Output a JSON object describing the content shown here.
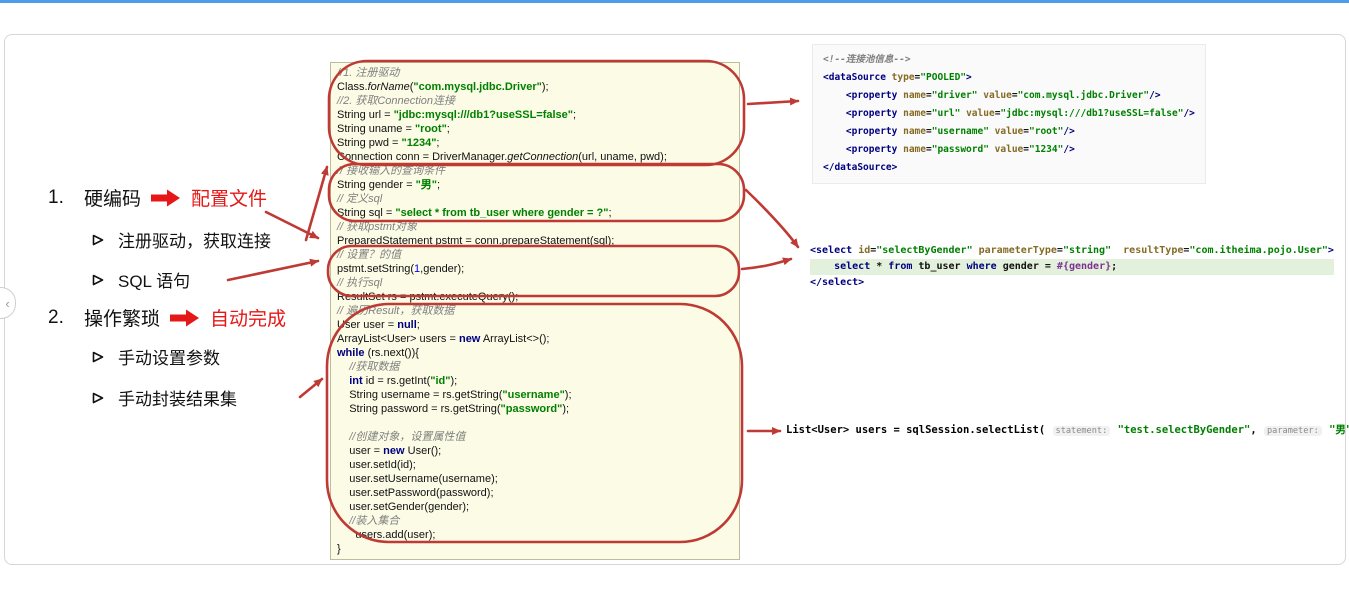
{
  "colors": {
    "top_bar_blue": "#4E9DE9",
    "accent_red_bright": "#E51717",
    "annotation_red": "#BE3A34",
    "code_bg_yellow": "#FBFBE6",
    "string_green": "#008000",
    "keyword_navy": "#000080",
    "highlight_green_bg": "#E3F1DC"
  },
  "side_tab": {
    "glyph": "‹"
  },
  "slide": {
    "outline_items": [
      {
        "number": "1.",
        "title": "硬编码",
        "tag": "配置文件",
        "children": [
          "注册驱动，获取连接",
          "SQL 语句"
        ]
      },
      {
        "number": "2.",
        "title": "操作繁琐",
        "tag": "自动完成",
        "children": [
          "手动设置参数",
          "手动封装结果集"
        ]
      }
    ]
  },
  "java_code": {
    "lines": [
      {
        "tk": [
          [
            "c",
            "//1. 注册驱动"
          ]
        ]
      },
      {
        "tk": [
          [
            "t",
            "Class."
          ],
          [
            "i",
            "forName"
          ],
          [
            "t",
            "("
          ],
          [
            "s",
            "\"com.mysql.jdbc.Driver\""
          ],
          [
            "t",
            ");"
          ]
        ]
      },
      {
        "tk": [
          [
            "c",
            "//2. 获取Connection连接"
          ]
        ]
      },
      {
        "tk": [
          [
            "t",
            "String url = "
          ],
          [
            "s",
            "\"jdbc:mysql:///db1?useSSL=false\""
          ],
          [
            "t",
            ";"
          ]
        ]
      },
      {
        "tk": [
          [
            "t",
            "String uname = "
          ],
          [
            "s",
            "\"root\""
          ],
          [
            "t",
            ";"
          ]
        ]
      },
      {
        "tk": [
          [
            "t",
            "String pwd = "
          ],
          [
            "s",
            "\"1234\""
          ],
          [
            "t",
            ";"
          ]
        ]
      },
      {
        "tk": [
          [
            "t",
            "Connection conn = DriverManager."
          ],
          [
            "i",
            "getConnection"
          ],
          [
            "t",
            "(url, uname, pwd);"
          ]
        ]
      },
      {
        "tk": [
          [
            "c",
            "// 接收输入的查询条件"
          ]
        ]
      },
      {
        "tk": [
          [
            "t",
            "String gender = "
          ],
          [
            "s",
            "\"男\""
          ],
          [
            "t",
            ";"
          ]
        ]
      },
      {
        "tk": [
          [
            "c",
            "// 定义sql"
          ]
        ]
      },
      {
        "tk": [
          [
            "t",
            "String sql = "
          ],
          [
            "s",
            "\"select * from tb_user where gender = ?\""
          ],
          [
            "t",
            ";"
          ]
        ]
      },
      {
        "tk": [
          [
            "c",
            "// 获取pstmt对象"
          ]
        ]
      },
      {
        "tk": [
          [
            "t",
            "PreparedStatement pstmt = conn.prepareStatement(sql);"
          ]
        ]
      },
      {
        "tk": [
          [
            "c",
            "// 设置？的值"
          ]
        ]
      },
      {
        "tk": [
          [
            "t",
            "pstmt.setString("
          ],
          [
            "n",
            "1"
          ],
          [
            "t",
            ",gender);"
          ]
        ]
      },
      {
        "tk": [
          [
            "c",
            "// 执行sql"
          ]
        ]
      },
      {
        "tk": [
          [
            "t",
            "ResultSet rs = pstmt.executeQuery();"
          ]
        ]
      },
      {
        "tk": [
          [
            "c",
            "// 遍历Result，获取数据"
          ]
        ]
      },
      {
        "tk": [
          [
            "t",
            "User user = "
          ],
          [
            "k",
            "null"
          ],
          [
            "t",
            ";"
          ]
        ]
      },
      {
        "tk": [
          [
            "t",
            "ArrayList<User> users = "
          ],
          [
            "k",
            "new"
          ],
          [
            "t",
            " ArrayList<>();"
          ]
        ]
      },
      {
        "tk": [
          [
            "k",
            "while"
          ],
          [
            "t",
            " (rs.next()){"
          ]
        ]
      },
      {
        "tk": [
          [
            "c",
            "    //获取数据"
          ]
        ]
      },
      {
        "tk": [
          [
            "t",
            "    "
          ],
          [
            "k",
            "int"
          ],
          [
            "t",
            " id = rs.getInt("
          ],
          [
            "s",
            "\"id\""
          ],
          [
            "t",
            ");"
          ]
        ]
      },
      {
        "tk": [
          [
            "t",
            "    String username = rs.getString("
          ],
          [
            "s",
            "\"username\""
          ],
          [
            "t",
            ");"
          ]
        ]
      },
      {
        "tk": [
          [
            "t",
            "    String password = rs.getString("
          ],
          [
            "s",
            "\"password\""
          ],
          [
            "t",
            ");"
          ]
        ]
      },
      {
        "tk": []
      },
      {
        "tk": [
          [
            "c",
            "    //创建对象，设置属性值"
          ]
        ]
      },
      {
        "tk": [
          [
            "t",
            "    user = "
          ],
          [
            "k",
            "new"
          ],
          [
            "t",
            " User();"
          ]
        ]
      },
      {
        "tk": [
          [
            "t",
            "    user.setId(id);"
          ]
        ]
      },
      {
        "tk": [
          [
            "t",
            "    user.setUsername(username);"
          ]
        ]
      },
      {
        "tk": [
          [
            "t",
            "    user.setPassword(password);"
          ]
        ]
      },
      {
        "tk": [
          [
            "t",
            "    user.setGender(gender);"
          ]
        ]
      },
      {
        "tk": [
          [
            "c",
            "    //装入集合"
          ]
        ]
      },
      {
        "tk": [
          [
            "t",
            "      users.add(user);"
          ]
        ]
      },
      {
        "tk": [
          [
            "t",
            "}"
          ]
        ]
      }
    ]
  },
  "xml_datasource": {
    "lines": [
      {
        "tk": [
          [
            "c",
            "<!--连接池信息-->"
          ]
        ]
      },
      {
        "tk": [
          [
            "k",
            "<dataSource"
          ],
          [
            "t",
            " "
          ],
          [
            "a",
            "type"
          ],
          [
            "t",
            "="
          ],
          [
            "s",
            "\"POOLED\""
          ],
          [
            "k",
            ">"
          ]
        ]
      },
      {
        "tk": [
          [
            "t",
            "    "
          ],
          [
            "k",
            "<property"
          ],
          [
            "t",
            " "
          ],
          [
            "a",
            "name"
          ],
          [
            "t",
            "="
          ],
          [
            "s",
            "\"driver\""
          ],
          [
            "t",
            " "
          ],
          [
            "a",
            "value"
          ],
          [
            "t",
            "="
          ],
          [
            "s",
            "\"com.mysql.jdbc.Driver\""
          ],
          [
            "k",
            "/>"
          ]
        ]
      },
      {
        "tk": [
          [
            "t",
            "    "
          ],
          [
            "k",
            "<property"
          ],
          [
            "t",
            " "
          ],
          [
            "a",
            "name"
          ],
          [
            "t",
            "="
          ],
          [
            "s",
            "\"url\""
          ],
          [
            "t",
            " "
          ],
          [
            "a",
            "value"
          ],
          [
            "t",
            "="
          ],
          [
            "s",
            "\"jdbc:mysql:///db1?useSSL=false\""
          ],
          [
            "k",
            "/>"
          ]
        ]
      },
      {
        "tk": [
          [
            "t",
            "    "
          ],
          [
            "k",
            "<property"
          ],
          [
            "t",
            " "
          ],
          [
            "a",
            "name"
          ],
          [
            "t",
            "="
          ],
          [
            "s",
            "\"username\""
          ],
          [
            "t",
            " "
          ],
          [
            "a",
            "value"
          ],
          [
            "t",
            "="
          ],
          [
            "s",
            "\"root\""
          ],
          [
            "k",
            "/>"
          ]
        ]
      },
      {
        "tk": [
          [
            "t",
            "    "
          ],
          [
            "k",
            "<property"
          ],
          [
            "t",
            " "
          ],
          [
            "a",
            "name"
          ],
          [
            "t",
            "="
          ],
          [
            "s",
            "\"password\""
          ],
          [
            "t",
            " "
          ],
          [
            "a",
            "value"
          ],
          [
            "t",
            "="
          ],
          [
            "s",
            "\"1234\""
          ],
          [
            "k",
            "/>"
          ]
        ]
      },
      {
        "tk": [
          [
            "k",
            "</dataSource>"
          ]
        ]
      }
    ]
  },
  "xml_select": {
    "lines": [
      {
        "tk": [
          [
            "k",
            "<select"
          ],
          [
            "t",
            " "
          ],
          [
            "a",
            "id"
          ],
          [
            "t",
            "="
          ],
          [
            "s",
            "\"selectByGender\""
          ],
          [
            "t",
            " "
          ],
          [
            "a",
            "parameterType"
          ],
          [
            "t",
            "="
          ],
          [
            "s",
            "\"string\""
          ],
          [
            "t",
            "  "
          ],
          [
            "a",
            "resultType"
          ],
          [
            "t",
            "="
          ],
          [
            "s",
            "\"com.itheima.pojo.User\""
          ],
          [
            "k",
            ">"
          ]
        ]
      },
      {
        "hl": 1,
        "tk": [
          [
            "t",
            "    "
          ],
          [
            "k",
            "select"
          ],
          [
            "t",
            " * "
          ],
          [
            "k",
            "from"
          ],
          [
            "t",
            " "
          ],
          [
            "b",
            "tb_user"
          ],
          [
            "t",
            " "
          ],
          [
            "k",
            "where"
          ],
          [
            "t",
            " gender = "
          ],
          [
            "p",
            "#{gender}"
          ],
          [
            "t",
            ";"
          ]
        ]
      },
      {
        "tk": [
          [
            "k",
            "</select>"
          ]
        ]
      }
    ]
  },
  "mybatis_call": {
    "lines": [
      {
        "tk": [
          [
            "t",
            "List<User> users = sqlSession.selectList( "
          ],
          [
            "h",
            "statement:"
          ],
          [
            "s",
            " \"test.selectByGender\""
          ],
          [
            "t",
            ", "
          ],
          [
            "h",
            "parameter:"
          ],
          [
            "s",
            " \"男\""
          ],
          [
            "t",
            ");"
          ]
        ]
      }
    ]
  }
}
